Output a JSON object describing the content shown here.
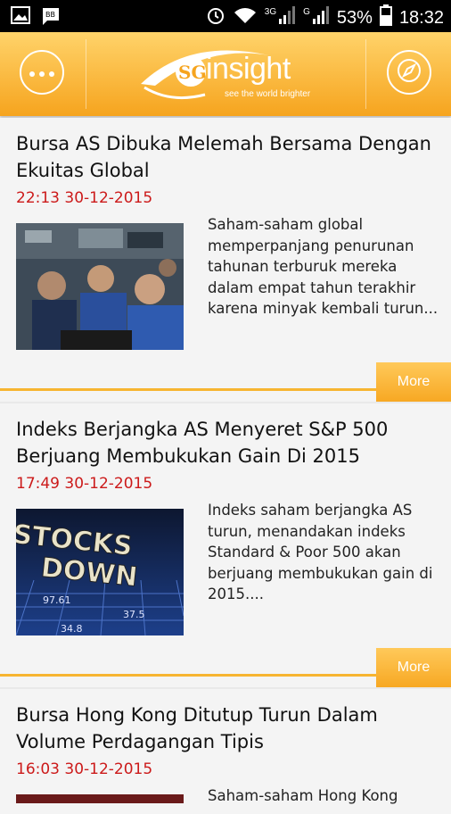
{
  "status_bar": {
    "net1_label": "3G",
    "net2_label": "G",
    "battery": "53%",
    "time": "18:32"
  },
  "header": {
    "logo_text": "insight",
    "logo_mark": "SG",
    "logo_tagline": "see the world brighter"
  },
  "articles": [
    {
      "title": "Bursa AS Dibuka Melemah Bersama Dengan Ekuitas Global",
      "date": "22:13 30-12-2015",
      "summary": "Saham-saham global memperpanjang penurunan tahunan terburuk mereka dalam empat tahun terakhir karena minyak kembali turun...",
      "more_label": "More"
    },
    {
      "title": "Indeks Berjangka AS Menyeret S&P 500 Berjuang Membukukan Gain Di 2015",
      "date": "17:49 30-12-2015",
      "summary": "Indeks saham berjangka AS turun, menandakan indeks Standard & Poor 500 akan berjuang membukukan gain di 2015....",
      "image_text": "STOCKS DOWN",
      "more_label": "More"
    },
    {
      "title": "Bursa Hong Kong Ditutup Turun Dalam Volume Perdagangan Tipis",
      "date": "16:03 30-12-2015",
      "summary": "Saham-saham Hong Kong"
    }
  ]
}
